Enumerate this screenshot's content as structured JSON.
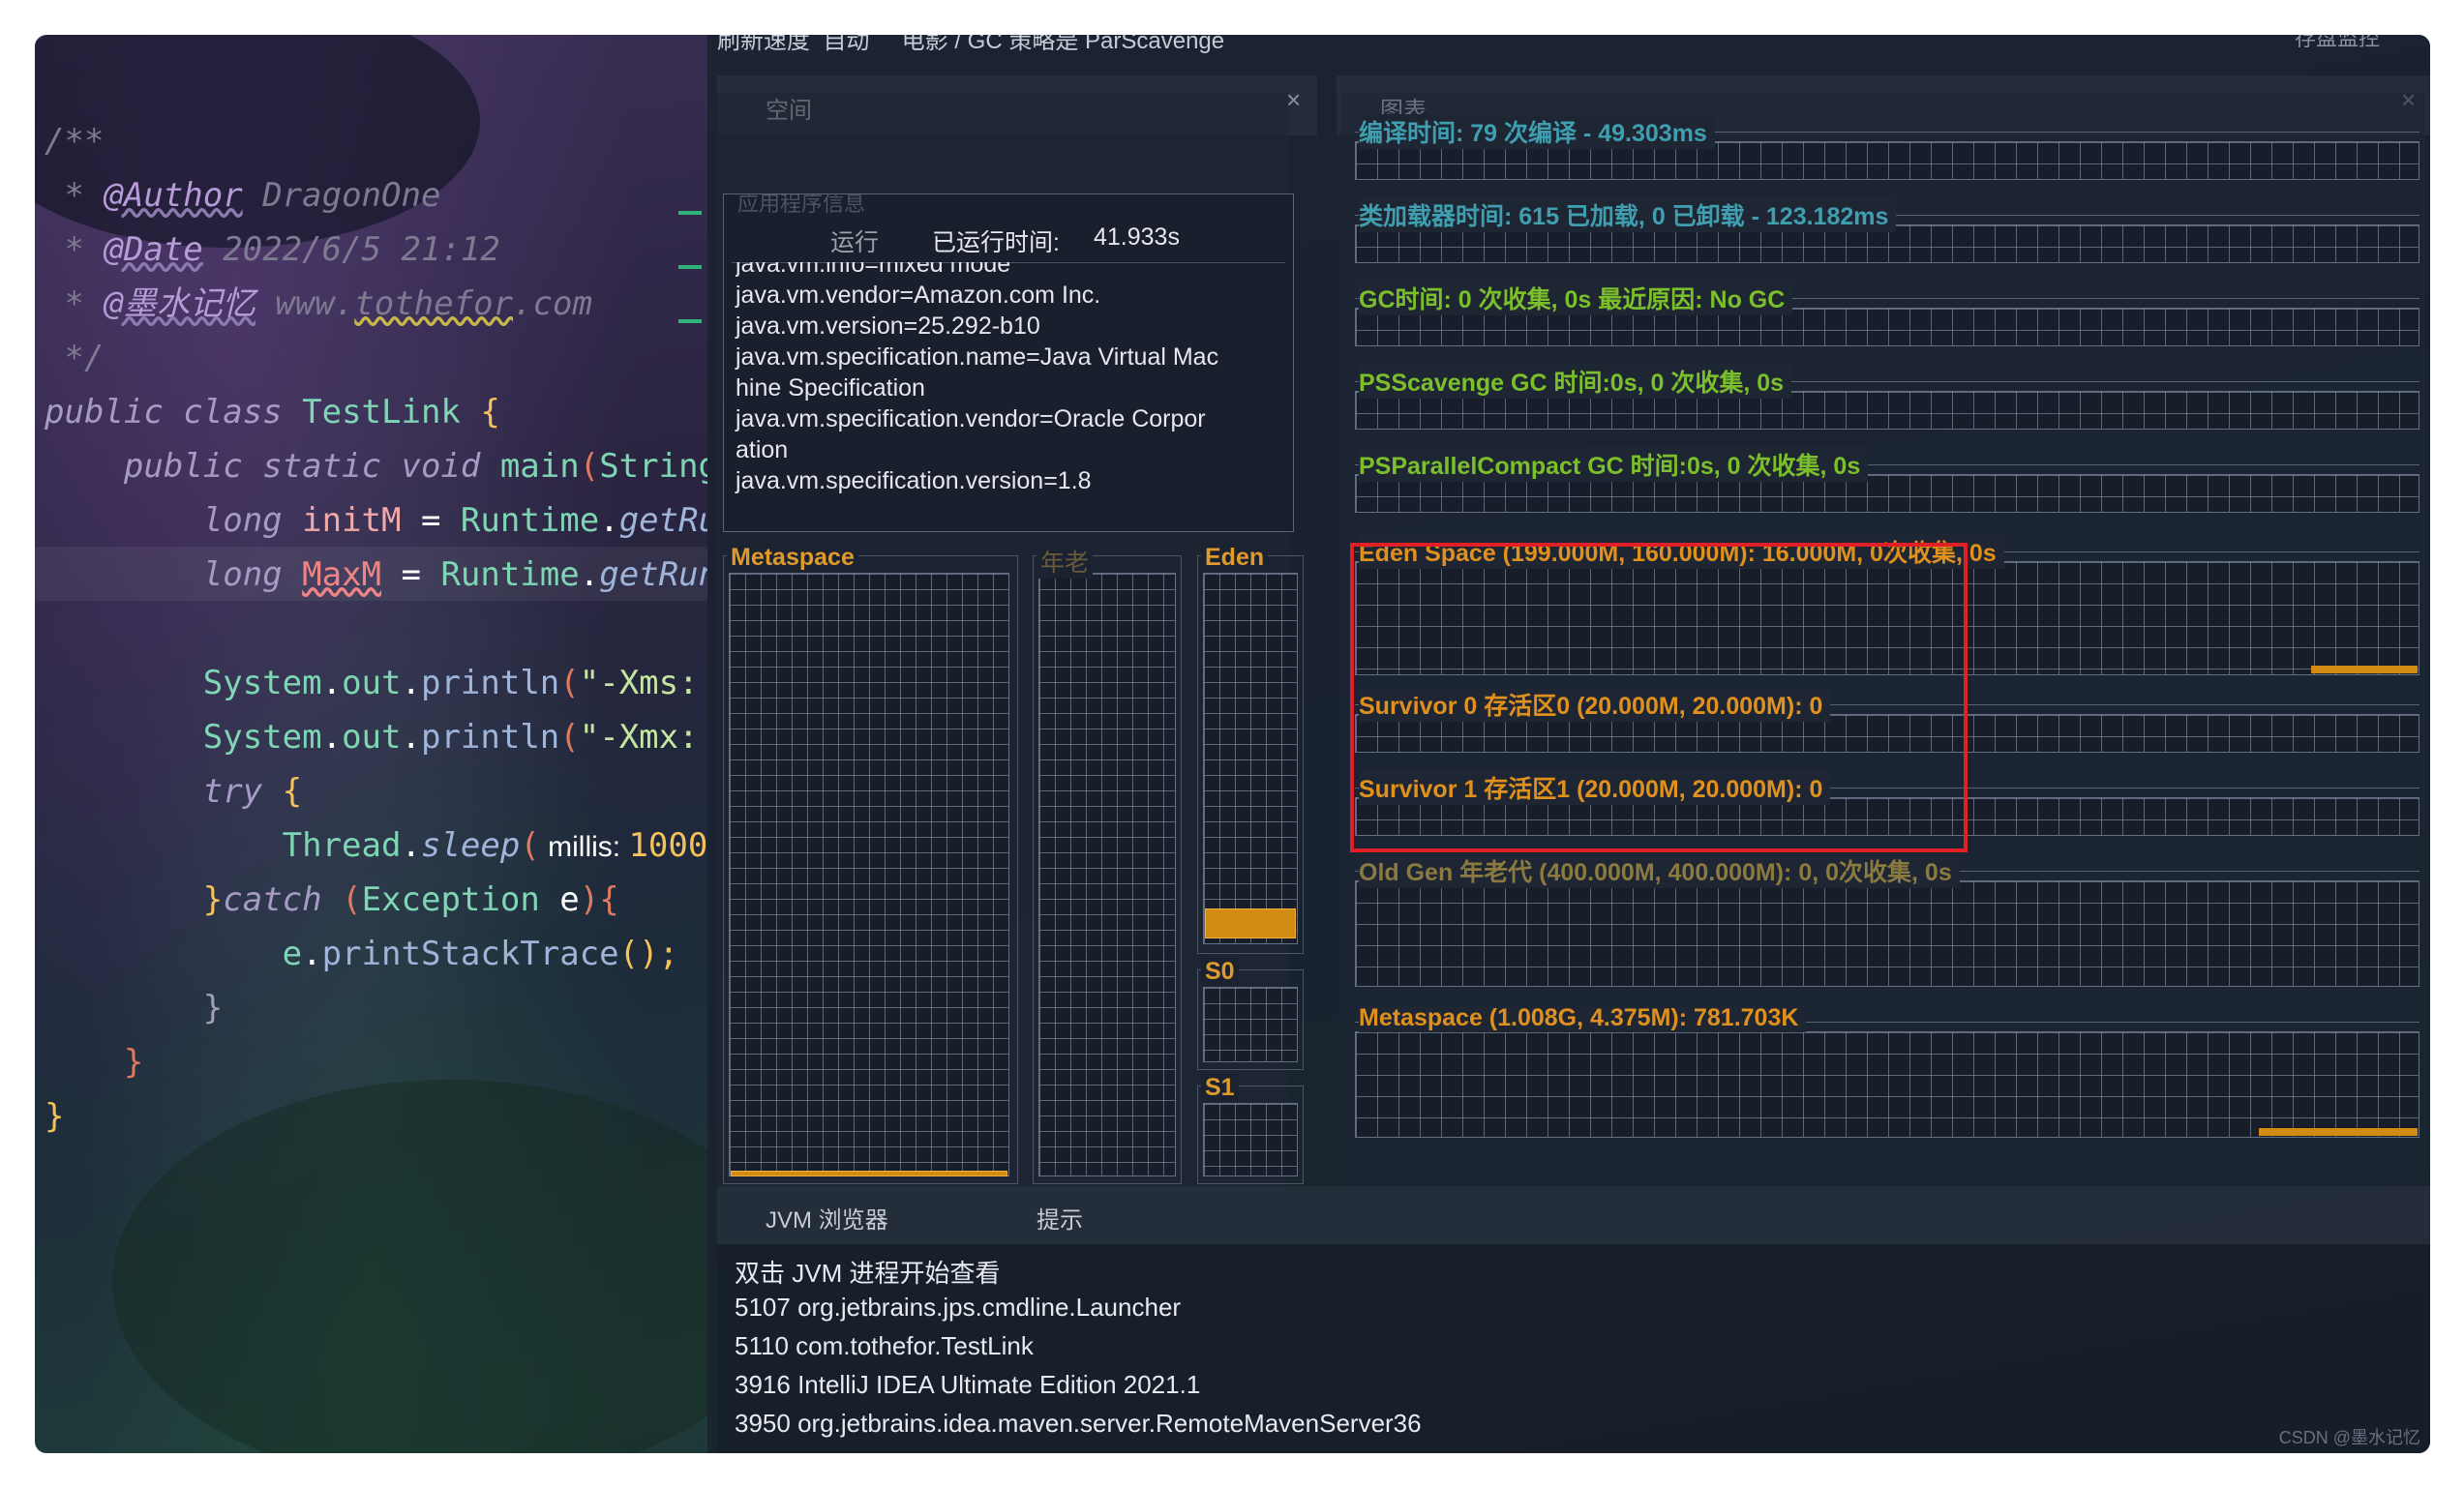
{
  "editor": {
    "lines": [
      {
        "text": "/**"
      },
      {
        "prefix": " * ",
        "tag": "@Author",
        "rest": " DragonOne"
      },
      {
        "prefix": " * ",
        "tag": "@Date",
        "rest": " 2022/6/5 21:12"
      },
      {
        "prefix": " * ",
        "tag": "@墨水记忆",
        "rest": " www.",
        "link": "tothefor",
        "rest2": ".com"
      },
      {
        "text": " */"
      },
      {
        "kw1": "public",
        "kw2": " class ",
        "cls": "TestLink",
        "br": " {"
      },
      {
        "indent": "    ",
        "kw1": "public",
        "kw2": " static void ",
        "fn": "main",
        "br": "(",
        "cls": "String"
      },
      {
        "indent": "        ",
        "kw": "long ",
        "var": "initM",
        "op": " = ",
        "cls": "Runtime",
        "dot": ".",
        "mt": "getRu"
      },
      {
        "indent": "        ",
        "kw": "long ",
        "var": "MaxM",
        "op": " = ",
        "cls": "Runtime",
        "dot": ".",
        "mt": "getRun"
      },
      {
        "indent": "        ",
        "cls": "System",
        "dot": ".",
        "fld": "out",
        "dot2": ".",
        "mt": "println",
        "br": "(",
        "st": "\"-Xms: "
      },
      {
        "indent": "        ",
        "cls": "System",
        "dot": ".",
        "fld": "out",
        "dot2": ".",
        "mt": "println",
        "br": "(",
        "st": "\"-Xmx: "
      },
      {
        "indent": "        ",
        "kw": "try",
        "br": " {"
      },
      {
        "indent": "            ",
        "cls": "Thread",
        "dot": ".",
        "mt": "sleep",
        "br": "(",
        "hint": " millis: ",
        "num": "1000"
      },
      {
        "indent": "        ",
        "br": "}",
        "kw": "catch",
        "br2": " (",
        "cls": "Exception",
        "var": " e",
        "br3": "){"
      },
      {
        "indent": "            ",
        "cls": "e",
        "dot": ".",
        "mt": "printStackTrace",
        "br": "();"
      },
      {
        "indent": "        ",
        "br": "}"
      },
      {
        "indent": "    ",
        "br": "}"
      },
      {
        "br": "}"
      }
    ]
  },
  "window": {
    "top_tabs_partial": [
      "刷新速度",
      "自动",
      "  电影 / GC 策略是 ParScavenge",
      "存盘监控"
    ],
    "left_tab": "空间",
    "right_tab": "图表",
    "close_glyph": "×"
  },
  "app_info": {
    "section": "应用程序信息",
    "status": "运行",
    "uptime_label": "已运行时间:",
    "uptime_value": "41.933s",
    "properties": [
      "java.vm.info=mixed mode",
      "java.vm.vendor=Amazon.com Inc.",
      "java.vm.version=25.292-b10",
      "java.vm.specification.name=Java Virtual Mac",
      "hine Specification",
      "java.vm.specification.vendor=Oracle Corpor",
      "ation",
      "java.vm.specification.version=1.8"
    ]
  },
  "spaces": {
    "metaspace": "Metaspace",
    "old": "年老",
    "eden": "Eden",
    "s0": "S0",
    "s1": "S1",
    "eden_fill_fraction": 0.08,
    "metaspace_fill_fraction": 0.01
  },
  "charts": [
    {
      "label": "编译时间: 79 次编译 - 49.303ms",
      "color": "teal"
    },
    {
      "label": "类加载器时间: 615 已加载, 0 已卸载 - 123.182ms",
      "color": "teal"
    },
    {
      "label": "GC时间: 0 次收集, 0s 最近原因: No GC",
      "color": "green"
    },
    {
      "label": "PSScavenge GC 时间:0s, 0 次收集, 0s",
      "color": "green"
    },
    {
      "label": "PSParallelCompact GC 时间:0s, 0 次收集, 0s",
      "color": "green"
    },
    {
      "label": "Eden Space (199.000M, 160.000M): 16.000M, 0次收集, 0s",
      "color": "orange",
      "fill_fraction": 0.1
    },
    {
      "label": "Survivor 0 存活区0 (20.000M, 20.000M): 0",
      "color": "orange"
    },
    {
      "label": "Survivor 1 存活区1 (20.000M, 20.000M): 0",
      "color": "orange"
    },
    {
      "label": "Old Gen 年老代 (400.000M, 400.000M): 0, 0次收集, 0s",
      "color": "dimorange"
    },
    {
      "label": "Metaspace (1.008G, 4.375M): 781.703K",
      "color": "orange",
      "fill_fraction": 0.15
    }
  ],
  "bottom": {
    "tabs": [
      "JVM 浏览器",
      "提示"
    ],
    "header": "双击 JVM 进程开始查看",
    "processes": [
      "5107 org.jetbrains.jps.cmdline.Launcher",
      "5110 com.tothefor.TestLink",
      "3916 IntelliJ IDEA Ultimate Edition 2021.1",
      "3950 org.jetbrains.idea.maven.server.RemoteMavenServer36"
    ]
  },
  "watermark": "CSDN @墨水记忆",
  "colors": {
    "highlight_box": "#e01f26",
    "bar_fill": "#d28c14",
    "teal_label": "#3f9fb0",
    "green_label": "#7bbf2a",
    "orange_label": "#e0901c"
  }
}
